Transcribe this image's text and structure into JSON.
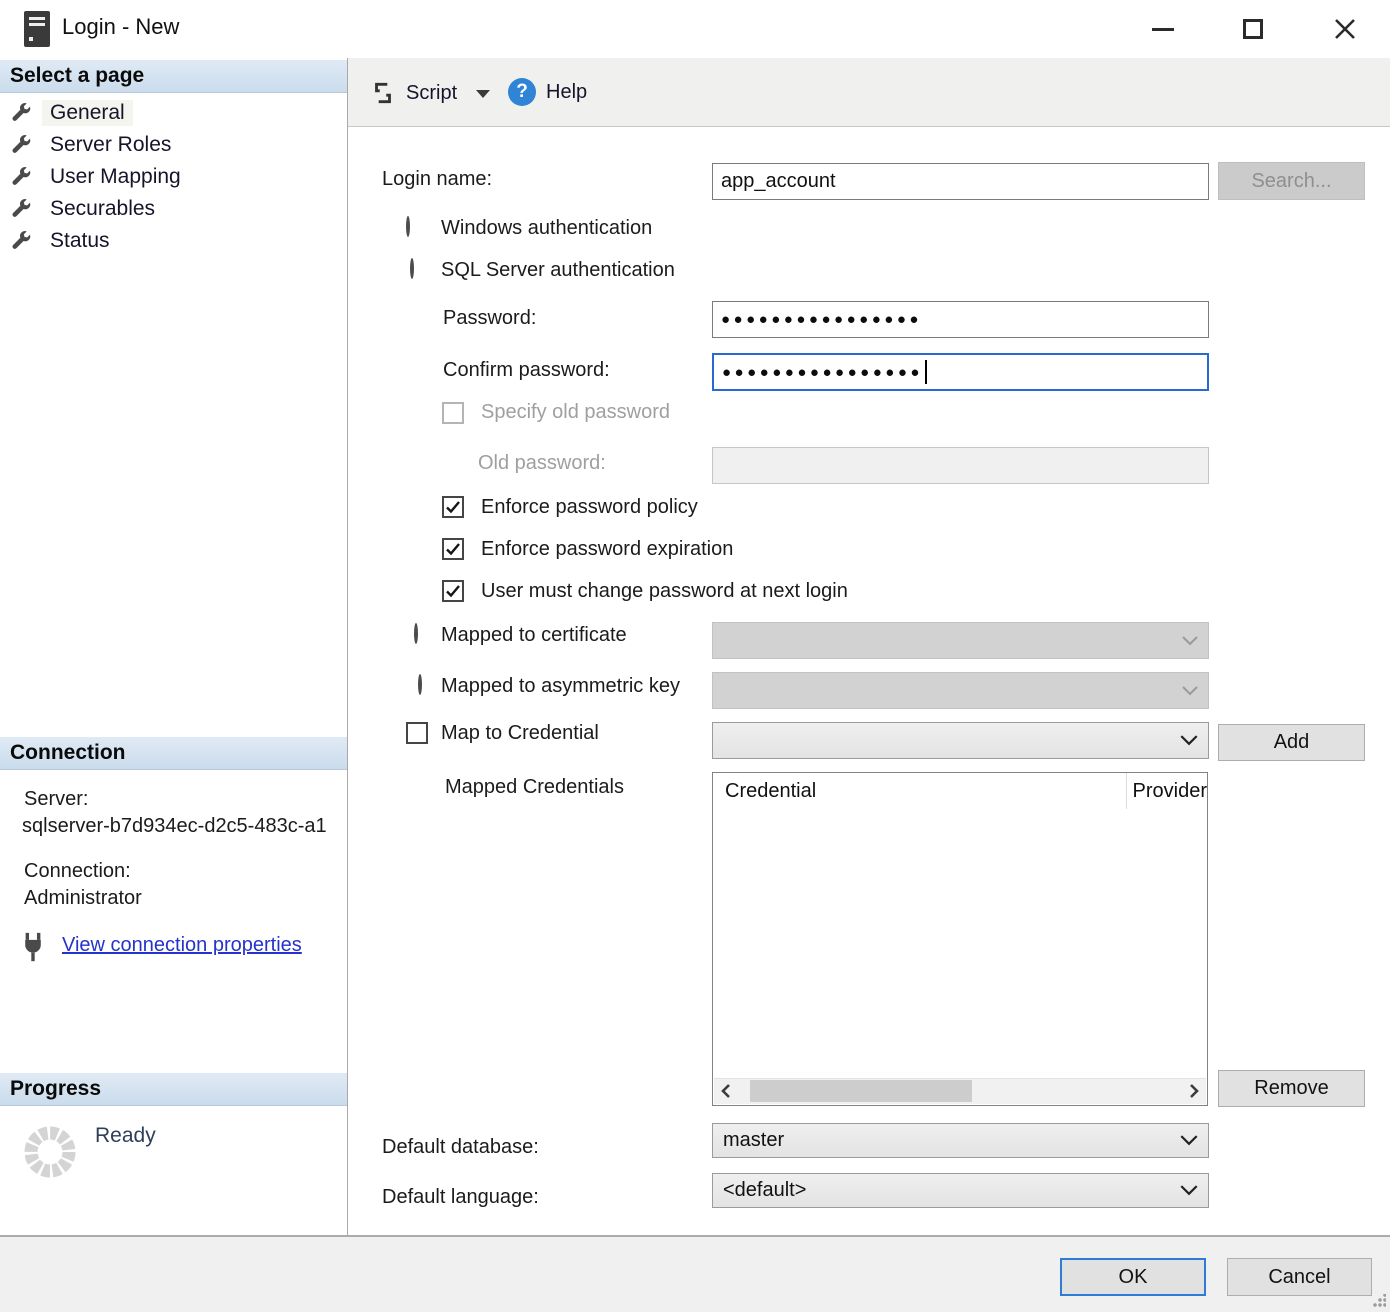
{
  "window": {
    "title": "Login - New",
    "icon": "server-icon",
    "controls": {
      "minimize": "minimize-icon",
      "maximize": "maximize-icon",
      "close": "close-icon"
    }
  },
  "sidebar": {
    "select_page_header": "Select a page",
    "items": [
      {
        "label": "General",
        "selected": true,
        "icon": "wrench-icon"
      },
      {
        "label": "Server Roles",
        "selected": false,
        "icon": "wrench-icon"
      },
      {
        "label": "User Mapping",
        "selected": false,
        "icon": "wrench-icon"
      },
      {
        "label": "Securables",
        "selected": false,
        "icon": "wrench-icon"
      },
      {
        "label": "Status",
        "selected": false,
        "icon": "wrench-icon"
      }
    ],
    "connection": {
      "header": "Connection",
      "server_label": "Server:",
      "server_value": "sqlserver-b7d934ec-d2c5-483c-a1",
      "connection_label": "Connection:",
      "connection_value": "Administrator",
      "view_link": "View connection properties",
      "view_link_icon": "plug-icon"
    },
    "progress": {
      "header": "Progress",
      "status": "Ready",
      "spinner_icon": "progress-spinner-icon"
    }
  },
  "toolbar": {
    "script_label": "Script",
    "script_icon": "script-scroll-icon",
    "dropdown_icon": "chevron-down-icon",
    "help_label": "Help",
    "help_icon": "help-question-icon"
  },
  "form": {
    "login_name_label": "Login name:",
    "login_name_value": "app_account",
    "search_button": "Search...",
    "windows_auth_label": "Windows authentication",
    "windows_auth_selected": false,
    "sql_auth_label": "SQL Server authentication",
    "sql_auth_selected": true,
    "password_label": "Password:",
    "password_value": "●●●●●●●●●●●●●●●●",
    "confirm_password_label": "Confirm password:",
    "confirm_password_value": "●●●●●●●●●●●●●●●●",
    "specify_old_password_label": "Specify old password",
    "specify_old_password_checked": false,
    "old_password_label": "Old password:",
    "old_password_value": "",
    "enforce_policy_label": "Enforce password policy",
    "enforce_policy_checked": true,
    "enforce_expiration_label": "Enforce password expiration",
    "enforce_expiration_checked": true,
    "must_change_label": "User must change password at next login",
    "must_change_checked": true,
    "mapped_certificate_label": "Mapped to certificate",
    "mapped_certificate_selected": false,
    "mapped_asymmetric_label": "Mapped to asymmetric key",
    "mapped_asymmetric_selected": false,
    "map_credential_label": "Map to Credential",
    "map_credential_checked": false,
    "add_button": "Add",
    "mapped_credentials_label": "Mapped Credentials",
    "credentials_columns": [
      "Credential",
      "Provider"
    ],
    "credentials_rows": [],
    "remove_button": "Remove",
    "default_database_label": "Default database:",
    "default_database_value": "master",
    "default_language_label": "Default language:",
    "default_language_value": "<default>"
  },
  "footer": {
    "ok_button": "OK",
    "cancel_button": "Cancel"
  },
  "colors": {
    "section_header_bg": "#d5e2f0",
    "focus_border": "#2a6ad0",
    "ok_focus_border": "#2f7cd6",
    "link": "#2533cc",
    "help_icon_blue": "#2f84d6",
    "toolbar_bg": "#f0f0ef",
    "footer_bg": "#f0f0f0",
    "disabled_text": "#9f9f9f",
    "ready_text": "#2e3f5a"
  }
}
